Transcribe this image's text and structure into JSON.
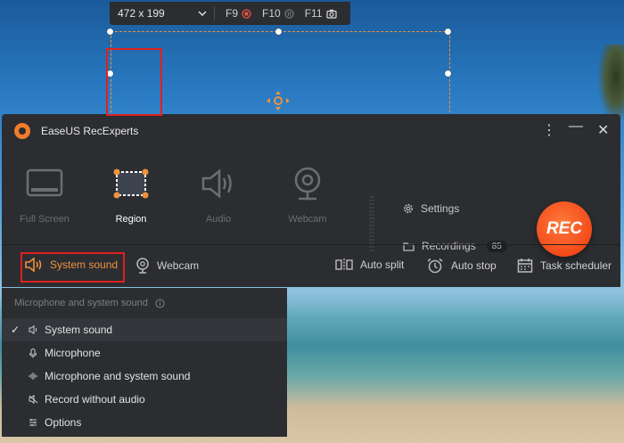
{
  "toolbar": {
    "dimensions": "472 x 199",
    "shortcuts": [
      {
        "key": "F9",
        "icon": "stop-record-icon"
      },
      {
        "key": "F10",
        "icon": "pause-icon"
      },
      {
        "key": "F11",
        "icon": "screenshot-icon"
      }
    ]
  },
  "app": {
    "title": "EaseUS RecExperts",
    "modes": [
      "Full Screen",
      "Region",
      "Audio",
      "Webcam"
    ],
    "active_mode": "Region",
    "settings_label": "Settings",
    "recordings_label": "Recordings",
    "recordings_count": "85",
    "rec_label": "REC"
  },
  "bottom": {
    "system_sound": "System sound",
    "webcam": "Webcam",
    "auto_split": "Auto split",
    "auto_stop": "Auto stop",
    "task_scheduler": "Task scheduler"
  },
  "dropdown": {
    "header": "Microphone and system sound",
    "items": [
      {
        "label": "System sound",
        "icon": "speaker-icon",
        "checked": true
      },
      {
        "label": "Microphone",
        "icon": "microphone-icon",
        "checked": false
      },
      {
        "label": "Microphone and system sound",
        "icon": "sound-wave-icon",
        "checked": false
      },
      {
        "label": "Record without audio",
        "icon": "muted-speaker-icon",
        "checked": false
      },
      {
        "label": "Options",
        "icon": "settings-sliders-icon",
        "checked": false
      }
    ],
    "check_mark": "✓"
  },
  "colors": {
    "accent": "#f0923c",
    "rec": "#f24a1a",
    "highlight_border": "#e02020",
    "panel": "#2b2d31"
  }
}
